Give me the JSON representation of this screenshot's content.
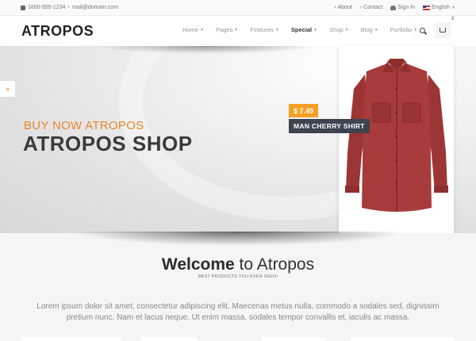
{
  "topbar": {
    "phone": "1800-555-1234",
    "separator": "•",
    "email": "mail@domain.com",
    "about": "About",
    "contact": "Contact",
    "signin": "Sign In",
    "language": "English"
  },
  "header": {
    "logo": "ATROPOS",
    "nav": [
      {
        "label": "Home"
      },
      {
        "label": "Pages"
      },
      {
        "label": "Features"
      },
      {
        "label": "Special"
      },
      {
        "label": "Shop"
      },
      {
        "label": "Blog"
      },
      {
        "label": "Portfolio"
      }
    ],
    "cart_count": "3",
    "icons": {
      "search": "search-icon",
      "cart": "cart-icon"
    }
  },
  "hero": {
    "side_tab": "»",
    "subtitle": "BUY NOW ATROPOS",
    "title": "ATROPOS SHOP",
    "product": {
      "price": "$ 7.49",
      "name": "MAN CHERRY SHIRT"
    }
  },
  "welcome": {
    "title_bold": "Welcome",
    "title_rest": " to Atropos",
    "subtitle": "BEST PRODUCTS YOU EVER SEEN!",
    "text": "Lorem ipsum dolor sit amet, consectetur adipiscing elit. Maecenas metus nulla, commodo a sodales sed, dignissim pretium nunc. Nam et lacus neque. Ut enim massa, sodales tempor convallis et, iaculis ac massa."
  },
  "colors": {
    "accent": "#e8862a",
    "price_bg": "#f5a023",
    "name_bg": "#3d4450",
    "shirt": "#a33a3a"
  }
}
